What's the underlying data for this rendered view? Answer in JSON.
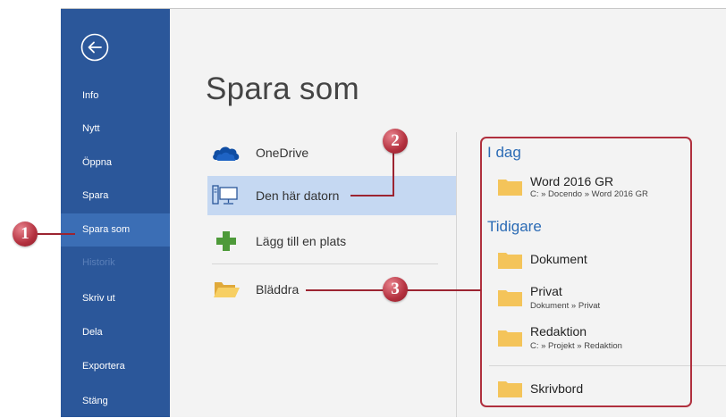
{
  "sidebar": {
    "items": [
      {
        "label": "Info"
      },
      {
        "label": "Nytt"
      },
      {
        "label": "Öppna"
      },
      {
        "label": "Spara"
      },
      {
        "label": "Spara som"
      },
      {
        "label": "Historik"
      },
      {
        "label": "Skriv ut"
      },
      {
        "label": "Dela"
      },
      {
        "label": "Exportera"
      },
      {
        "label": "Stäng"
      }
    ]
  },
  "main": {
    "title": "Spara som",
    "locations": [
      {
        "label": "OneDrive",
        "icon": "onedrive-cloud-icon"
      },
      {
        "label": "Den här datorn",
        "icon": "computer-icon"
      },
      {
        "label": "Lägg till en plats",
        "icon": "plus-icon"
      },
      {
        "label": "Bläddra",
        "icon": "folder-open-icon"
      }
    ]
  },
  "recent": {
    "today_heading": "I dag",
    "earlier_heading": "Tidigare",
    "today": [
      {
        "name": "Word 2016 GR",
        "path": "C: » Docendo » Word 2016 GR"
      }
    ],
    "earlier": [
      {
        "name": "Dokument",
        "path": ""
      },
      {
        "name": "Privat",
        "path": "Dokument » Privat"
      },
      {
        "name": "Redaktion",
        "path": "C: » Projekt » Redaktion"
      },
      {
        "name": "Skrivbord",
        "path": ""
      }
    ]
  },
  "callouts": [
    "1",
    "2",
    "3"
  ],
  "colors": {
    "sidebar": "#2b579a",
    "selected_location": "#c5d8f2",
    "heading": "#2b6bb5",
    "callout": "#b3303e"
  }
}
